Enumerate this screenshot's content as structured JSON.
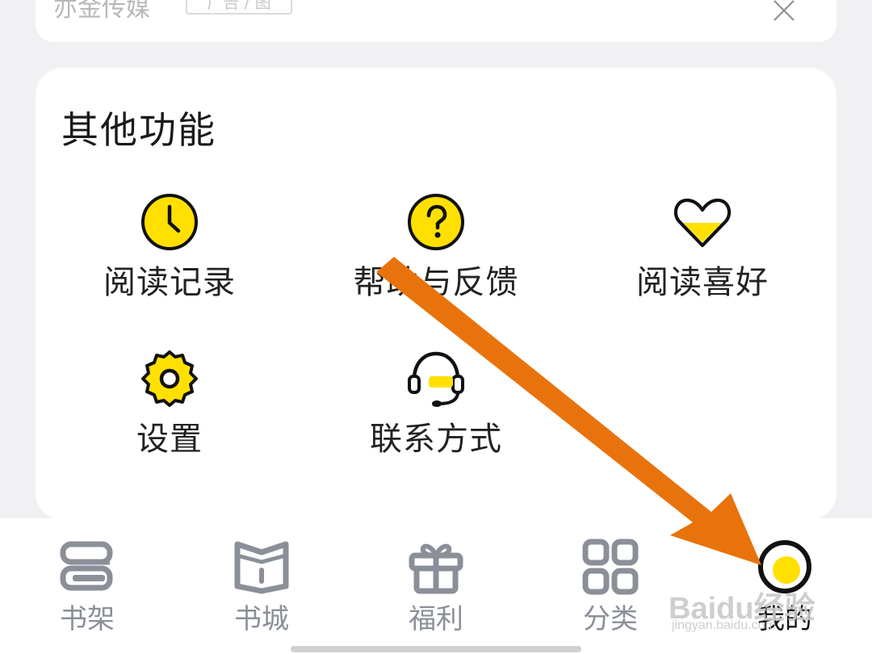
{
  "top_card": {
    "brand": "亦金传媒",
    "tag": "广告 / 图"
  },
  "section": {
    "title": "其他功能",
    "items": [
      {
        "label": "阅读记录",
        "icon": "clock-icon"
      },
      {
        "label": "帮助与反馈",
        "icon": "help-icon"
      },
      {
        "label": "阅读喜好",
        "icon": "heart-icon"
      },
      {
        "label": "设置",
        "icon": "gear-icon"
      },
      {
        "label": "联系方式",
        "icon": "headset-icon"
      }
    ]
  },
  "tabbar": {
    "tabs": [
      {
        "label": "书架",
        "icon": "bookshelf-icon"
      },
      {
        "label": "书城",
        "icon": "bookstore-icon"
      },
      {
        "label": "福利",
        "icon": "gift-icon"
      },
      {
        "label": "分类",
        "icon": "grid-icon"
      },
      {
        "label": "我的",
        "icon": "profile-icon",
        "active": true
      }
    ]
  },
  "watermark": {
    "main": "Baidu经验",
    "sub": "jingyan.baidu.com"
  },
  "colors": {
    "accent": "#ffe000",
    "arrow": "#e8730c",
    "inactive": "#8b8f98"
  }
}
